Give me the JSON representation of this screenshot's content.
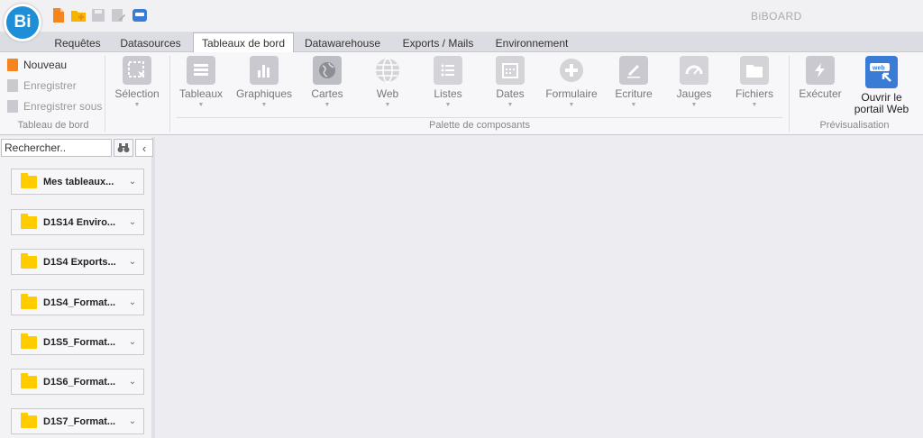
{
  "app": {
    "logo": "Bi",
    "title": "BiBOARD"
  },
  "quick_access": [
    {
      "name": "new-file-icon",
      "color": "#f5861f"
    },
    {
      "name": "new-folder-icon",
      "color": "#f5b400"
    },
    {
      "name": "save-icon",
      "color": "#c9c9cf"
    },
    {
      "name": "save-as-icon",
      "color": "#c9c9cf"
    },
    {
      "name": "portal-icon",
      "color": "#3a7bd5"
    }
  ],
  "tabs": [
    {
      "label": "Requêtes",
      "active": false
    },
    {
      "label": "Datasources",
      "active": false
    },
    {
      "label": "Tableaux de bord",
      "active": true
    },
    {
      "label": "Datawarehouse",
      "active": false
    },
    {
      "label": "Exports / Mails",
      "active": false
    },
    {
      "label": "Environnement",
      "active": false
    }
  ],
  "ribbon": {
    "tableau_de_bord": {
      "nouveau": "Nouveau",
      "enregistrer": "Enregistrer",
      "enregistrer_sous": "Enregistrer sous",
      "label": "Tableau de bord"
    },
    "selection": {
      "label": "Sélection"
    },
    "palette": {
      "items": [
        "Tableaux",
        "Graphiques",
        "Cartes",
        "Web",
        "Listes",
        "Dates",
        "Formulaire",
        "Ecriture",
        "Jauges",
        "Fichiers"
      ],
      "label": "Palette de composants"
    },
    "preview": {
      "executer": "Exécuter",
      "ouvrir": "Ouvrir le portail Web",
      "label": "Prévisualisation",
      "web_badge": "web"
    }
  },
  "sidebar": {
    "search_placeholder": "Rechercher..",
    "folders": [
      "Mes tableaux...",
      "D1S14 Enviro...",
      "D1S4 Exports...",
      "D1S4_Format...",
      "D1S5_Format...",
      "D1S6_Format...",
      "D1S7_Format..."
    ]
  },
  "colors": {
    "accent": "#1e8fd6",
    "folder": "#ffcc00",
    "new_icon": "#f5861f",
    "portal": "#3a7bd5"
  }
}
